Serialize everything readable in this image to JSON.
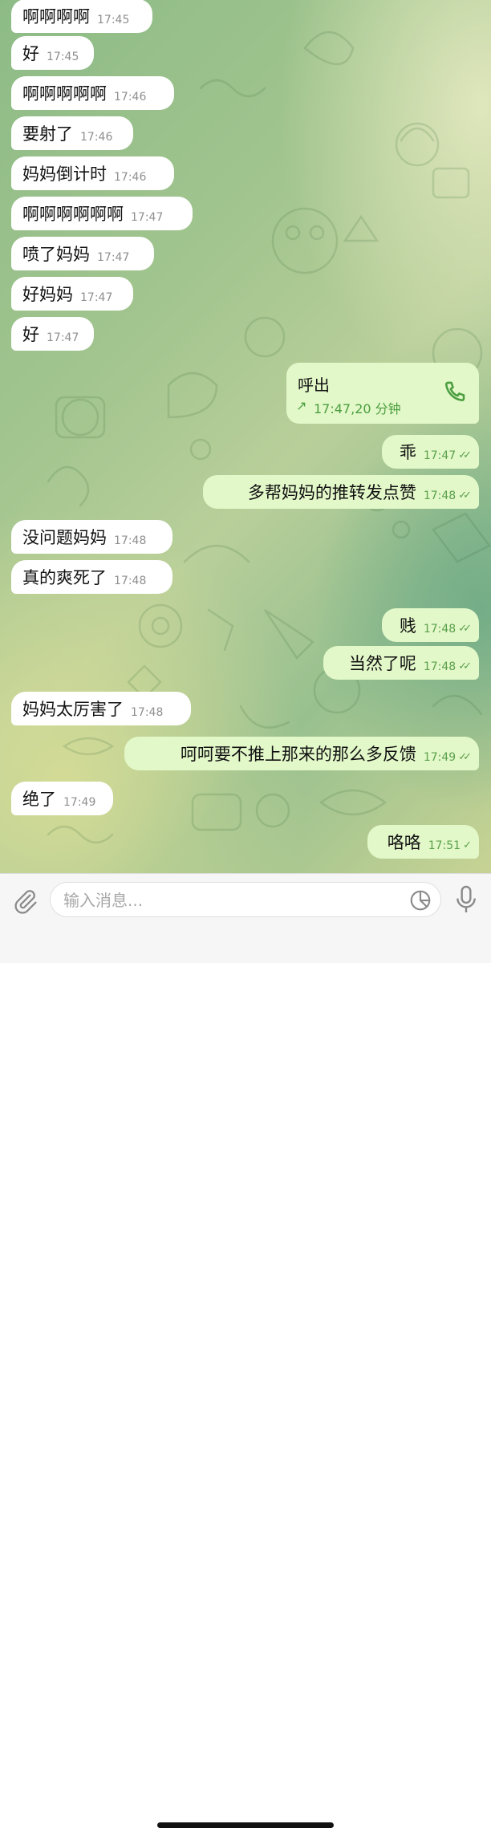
{
  "messages": [
    {
      "dir": "in",
      "text": "啊啊啊啊",
      "time": "17:45"
    },
    {
      "dir": "in",
      "text": "好",
      "time": "17:45"
    },
    {
      "dir": "in",
      "text": "啊啊啊啊啊",
      "time": "17:46"
    },
    {
      "dir": "in",
      "text": "要射了",
      "time": "17:46"
    },
    {
      "dir": "in",
      "text": "妈妈倒计时",
      "time": "17:46"
    },
    {
      "dir": "in",
      "text": "啊啊啊啊啊啊",
      "time": "17:47"
    },
    {
      "dir": "in",
      "text": "喷了妈妈",
      "time": "17:47"
    },
    {
      "dir": "in",
      "text": "好妈妈",
      "time": "17:47"
    },
    {
      "dir": "in",
      "text": "好",
      "time": "17:47"
    },
    {
      "dir": "out",
      "text": "乖",
      "time": "17:47",
      "status": "read"
    },
    {
      "dir": "out",
      "text": "多帮妈妈的推转发点赞",
      "time": "17:48",
      "status": "read"
    },
    {
      "dir": "in",
      "text": "没问题妈妈",
      "time": "17:48"
    },
    {
      "dir": "in",
      "text": "真的爽死了",
      "time": "17:48"
    },
    {
      "dir": "out",
      "text": "贱",
      "time": "17:48",
      "status": "read"
    },
    {
      "dir": "out",
      "text": "当然了呢",
      "time": "17:48",
      "status": "read"
    },
    {
      "dir": "in",
      "text": "妈妈太厉害了",
      "time": "17:48"
    },
    {
      "dir": "out",
      "text": "呵呵要不推上那来的那么多反馈",
      "time": "17:49",
      "status": "read"
    },
    {
      "dir": "in",
      "text": "绝了",
      "time": "17:49"
    },
    {
      "dir": "out",
      "text": "咯咯",
      "time": "17:51",
      "status": "delivered"
    }
  ],
  "call": {
    "title": "呼出",
    "detail": "17:47,20 分钟",
    "icon": "phone-icon",
    "direction_icon": "outgoing-arrow-icon"
  },
  "input": {
    "placeholder": "输入消息...",
    "attach_icon": "paperclip-icon",
    "sticker_icon": "sticker-icon",
    "mic_icon": "microphone-icon"
  },
  "colors": {
    "incoming_bubble": "#ffffff",
    "outgoing_bubble": "#e3f8c9",
    "outgoing_meta": "#5aa04c"
  }
}
